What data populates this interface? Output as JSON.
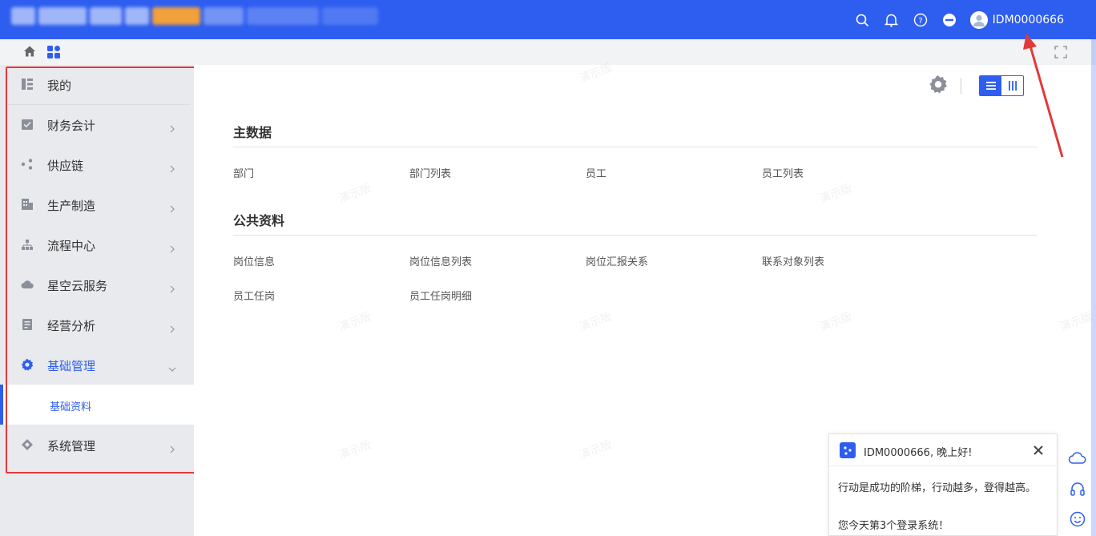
{
  "header": {
    "user_name": "IDM0000666",
    "icons": [
      "search-icon",
      "bell-icon",
      "help-icon",
      "minus-circle-icon",
      "avatar-icon"
    ]
  },
  "subbar": {
    "icons": [
      "home-icon",
      "apps-icon",
      "fullscreen-icon"
    ]
  },
  "sidebar": {
    "items": [
      {
        "label": "我的",
        "icon": "grid-list-icon",
        "has_arrow": false
      },
      {
        "label": "财务会计",
        "icon": "check-box-icon",
        "has_arrow": true
      },
      {
        "label": "供应链",
        "icon": "nodes-icon",
        "has_arrow": true
      },
      {
        "label": "生产制造",
        "icon": "building-icon",
        "has_arrow": true
      },
      {
        "label": "流程中心",
        "icon": "flow-icon",
        "has_arrow": true
      },
      {
        "label": "星空云服务",
        "icon": "cloud-icon",
        "has_arrow": true
      },
      {
        "label": "经营分析",
        "icon": "report-icon",
        "has_arrow": true
      },
      {
        "label": "基础管理",
        "icon": "gear-icon",
        "has_arrow": true,
        "expanded": true
      },
      {
        "label": "系统管理",
        "icon": "diamond-icon",
        "has_arrow": true
      }
    ],
    "submenu": {
      "label": "基础资料"
    }
  },
  "main": {
    "sections": [
      {
        "title": "主数据",
        "links": [
          "部门",
          "部门列表",
          "员工",
          "员工列表"
        ]
      },
      {
        "title": "公共资料",
        "links": [
          "岗位信息",
          "岗位信息列表",
          "岗位汇报关系",
          "联系对象列表",
          "员工任岗",
          "员工任岗明细"
        ]
      }
    ],
    "watermark": "演示版"
  },
  "popup": {
    "title": "IDM0000666, 晚上好!",
    "message1": "行动是成功的阶梯，行动越多，登得越高。",
    "message2": "您今天第3个登录系统！"
  },
  "colors": {
    "primary": "#2e5ef0",
    "annotation": "#e03a3a",
    "sidebar_bg": "#e9eaee"
  }
}
